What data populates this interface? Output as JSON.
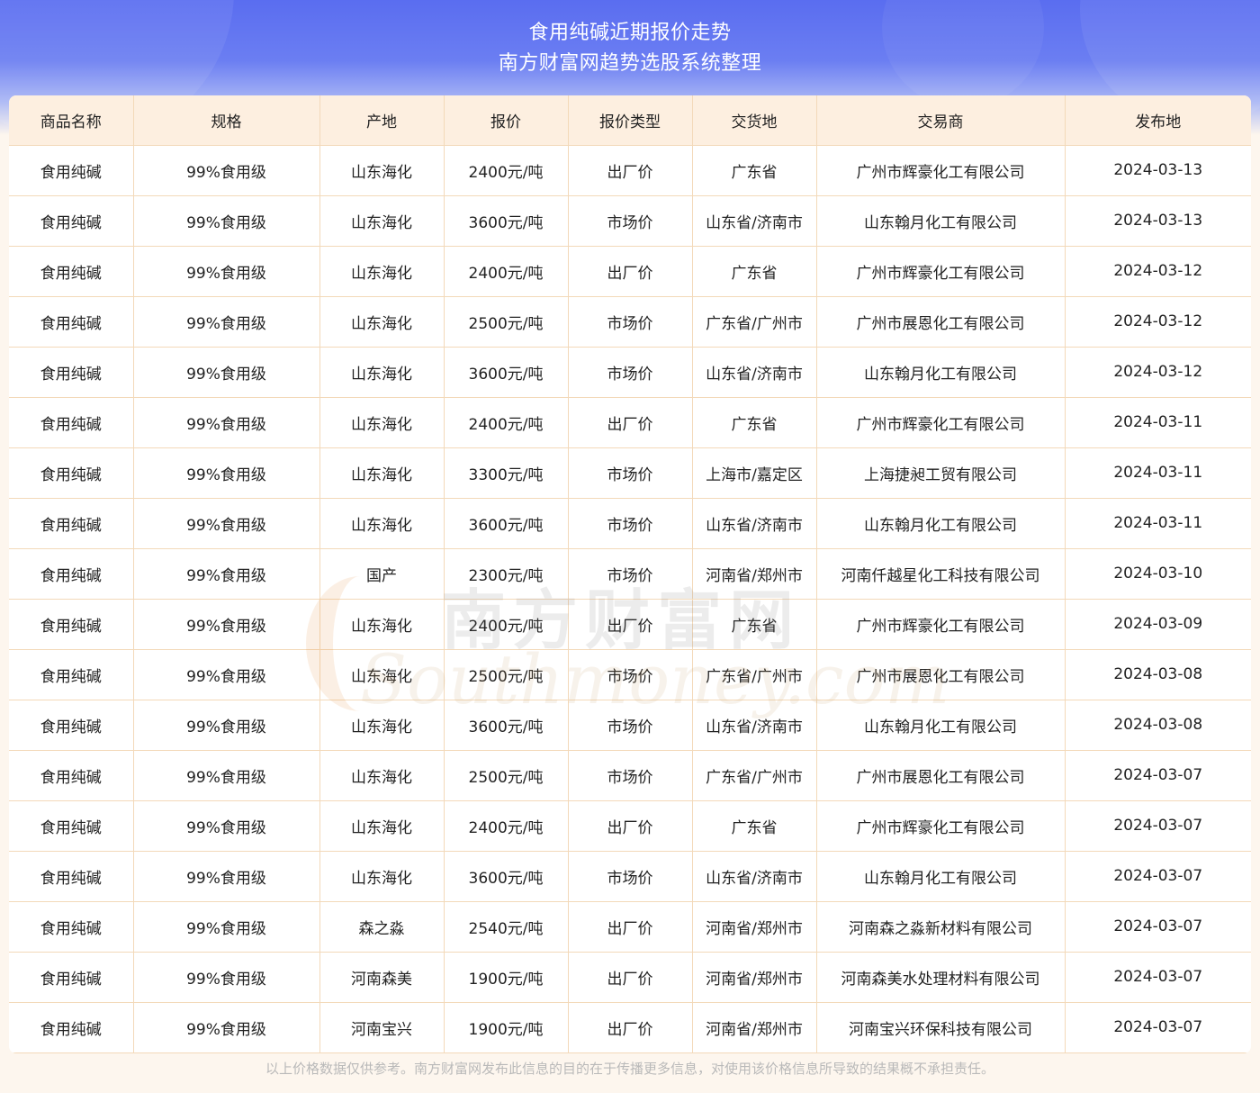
{
  "header": {
    "title_line1": "食用纯碱近期报价走势",
    "title_line2": "南方财富网趋势选股系统整理"
  },
  "table": {
    "columns": [
      "商品名称",
      "规格",
      "产地",
      "报价",
      "报价类型",
      "交货地",
      "交易商",
      "发布地"
    ],
    "rows": [
      [
        "食用纯碱",
        "99%食用级",
        "山东海化",
        "2400元/吨",
        "出厂价",
        "广东省",
        "广州市辉豪化工有限公司",
        "2024-03-13"
      ],
      [
        "食用纯碱",
        "99%食用级",
        "山东海化",
        "3600元/吨",
        "市场价",
        "山东省/济南市",
        "山东翰月化工有限公司",
        "2024-03-13"
      ],
      [
        "食用纯碱",
        "99%食用级",
        "山东海化",
        "2400元/吨",
        "出厂价",
        "广东省",
        "广州市辉豪化工有限公司",
        "2024-03-12"
      ],
      [
        "食用纯碱",
        "99%食用级",
        "山东海化",
        "2500元/吨",
        "市场价",
        "广东省/广州市",
        "广州市展恩化工有限公司",
        "2024-03-12"
      ],
      [
        "食用纯碱",
        "99%食用级",
        "山东海化",
        "3600元/吨",
        "市场价",
        "山东省/济南市",
        "山东翰月化工有限公司",
        "2024-03-12"
      ],
      [
        "食用纯碱",
        "99%食用级",
        "山东海化",
        "2400元/吨",
        "出厂价",
        "广东省",
        "广州市辉豪化工有限公司",
        "2024-03-11"
      ],
      [
        "食用纯碱",
        "99%食用级",
        "山东海化",
        "3300元/吨",
        "市场价",
        "上海市/嘉定区",
        "上海捷昶工贸有限公司",
        "2024-03-11"
      ],
      [
        "食用纯碱",
        "99%食用级",
        "山东海化",
        "3600元/吨",
        "市场价",
        "山东省/济南市",
        "山东翰月化工有限公司",
        "2024-03-11"
      ],
      [
        "食用纯碱",
        "99%食用级",
        "国产",
        "2300元/吨",
        "市场价",
        "河南省/郑州市",
        "河南仟越星化工科技有限公司",
        "2024-03-10"
      ],
      [
        "食用纯碱",
        "99%食用级",
        "山东海化",
        "2400元/吨",
        "出厂价",
        "广东省",
        "广州市辉豪化工有限公司",
        "2024-03-09"
      ],
      [
        "食用纯碱",
        "99%食用级",
        "山东海化",
        "2500元/吨",
        "市场价",
        "广东省/广州市",
        "广州市展恩化工有限公司",
        "2024-03-08"
      ],
      [
        "食用纯碱",
        "99%食用级",
        "山东海化",
        "3600元/吨",
        "市场价",
        "山东省/济南市",
        "山东翰月化工有限公司",
        "2024-03-08"
      ],
      [
        "食用纯碱",
        "99%食用级",
        "山东海化",
        "2500元/吨",
        "市场价",
        "广东省/广州市",
        "广州市展恩化工有限公司",
        "2024-03-07"
      ],
      [
        "食用纯碱",
        "99%食用级",
        "山东海化",
        "2400元/吨",
        "出厂价",
        "广东省",
        "广州市辉豪化工有限公司",
        "2024-03-07"
      ],
      [
        "食用纯碱",
        "99%食用级",
        "山东海化",
        "3600元/吨",
        "市场价",
        "山东省/济南市",
        "山东翰月化工有限公司",
        "2024-03-07"
      ],
      [
        "食用纯碱",
        "99%食用级",
        "森之淼",
        "2540元/吨",
        "出厂价",
        "河南省/郑州市",
        "河南森之淼新材料有限公司",
        "2024-03-07"
      ],
      [
        "食用纯碱",
        "99%食用级",
        "河南森美",
        "1900元/吨",
        "出厂价",
        "河南省/郑州市",
        "河南森美水处理材料有限公司",
        "2024-03-07"
      ],
      [
        "食用纯碱",
        "99%食用级",
        "河南宝兴",
        "1900元/吨",
        "出厂价",
        "河南省/郑州市",
        "河南宝兴环保科技有限公司",
        "2024-03-07"
      ]
    ]
  },
  "watermark": {
    "text_cn": "南方财富网",
    "text_en": "Southmoney.com"
  },
  "footer": {
    "disclaimer": "以上价格数据仅供参考。南方财富网发布此信息的目的在于传播更多信息，对使用该价格信息所导致的结果概不承担责任。"
  },
  "colors": {
    "banner_blue": "#5a6df0",
    "header_row_bg": "#fdefe0",
    "grid_line": "#f3d9b9",
    "page_bg": "#fdf6ee"
  }
}
